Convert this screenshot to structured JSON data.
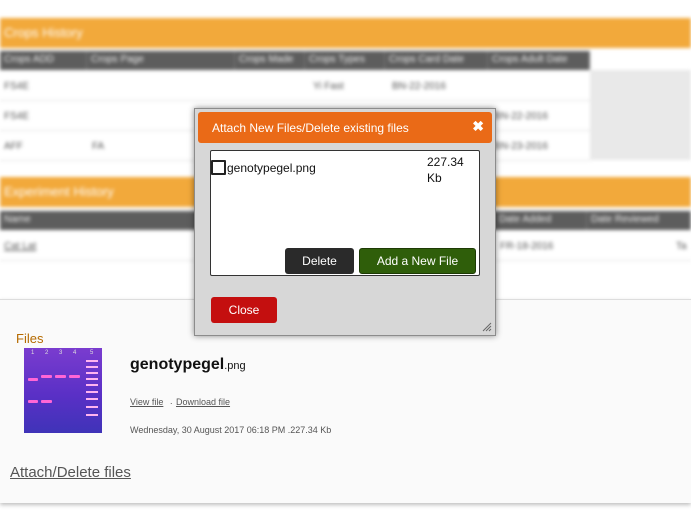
{
  "background": {
    "sections": [
      {
        "title": "Crops History",
        "columns": [
          "Crops ADD",
          "Crops Page",
          "Crops Made",
          "Crops Types",
          "Crops Card Date",
          "Crops Adult Date"
        ],
        "rows": [
          [
            "FS4E",
            "",
            "",
            "Yi Fast",
            "BN-22-2016",
            ""
          ],
          [
            "FS4E",
            "",
            "",
            "",
            "",
            "BN-22-2016"
          ],
          [
            "AFF",
            "FA",
            "",
            "",
            "",
            "BN-23-2016"
          ]
        ]
      },
      {
        "title": "Experiment History",
        "columns": [
          "Name",
          "Date Added",
          "Date Reviewed"
        ],
        "rows": [
          [
            "Cat Lat",
            "FR-18-2016",
            "Ta"
          ]
        ]
      }
    ]
  },
  "files_panel": {
    "title": "Files",
    "file_name": "genotypegel",
    "file_ext": ".png",
    "view_link": "View file",
    "separator": ".",
    "download_link": "Download file",
    "meta": "Wednesday, 30 August 2017 06:18 PM .227.34 Kb",
    "thumb_lanes": [
      "1",
      "2",
      "3",
      "4",
      "5"
    ],
    "attach_link": "Attach/Delete files"
  },
  "modal": {
    "title": "Attach New Files/Delete existing files",
    "close_icon": "close-x",
    "file_item": {
      "name": "genotypegel.png",
      "size": "227.34 Kb",
      "checked": false
    },
    "delete_label": "Delete",
    "add_label": "Add a New File",
    "close_label": "Close"
  },
  "colors": {
    "header_orange": "#ea6a17",
    "section_orange": "#f2a93b",
    "delete_button": "#2a2a2a",
    "add_button": "#2f5e0a",
    "close_button": "#c40f0f"
  }
}
